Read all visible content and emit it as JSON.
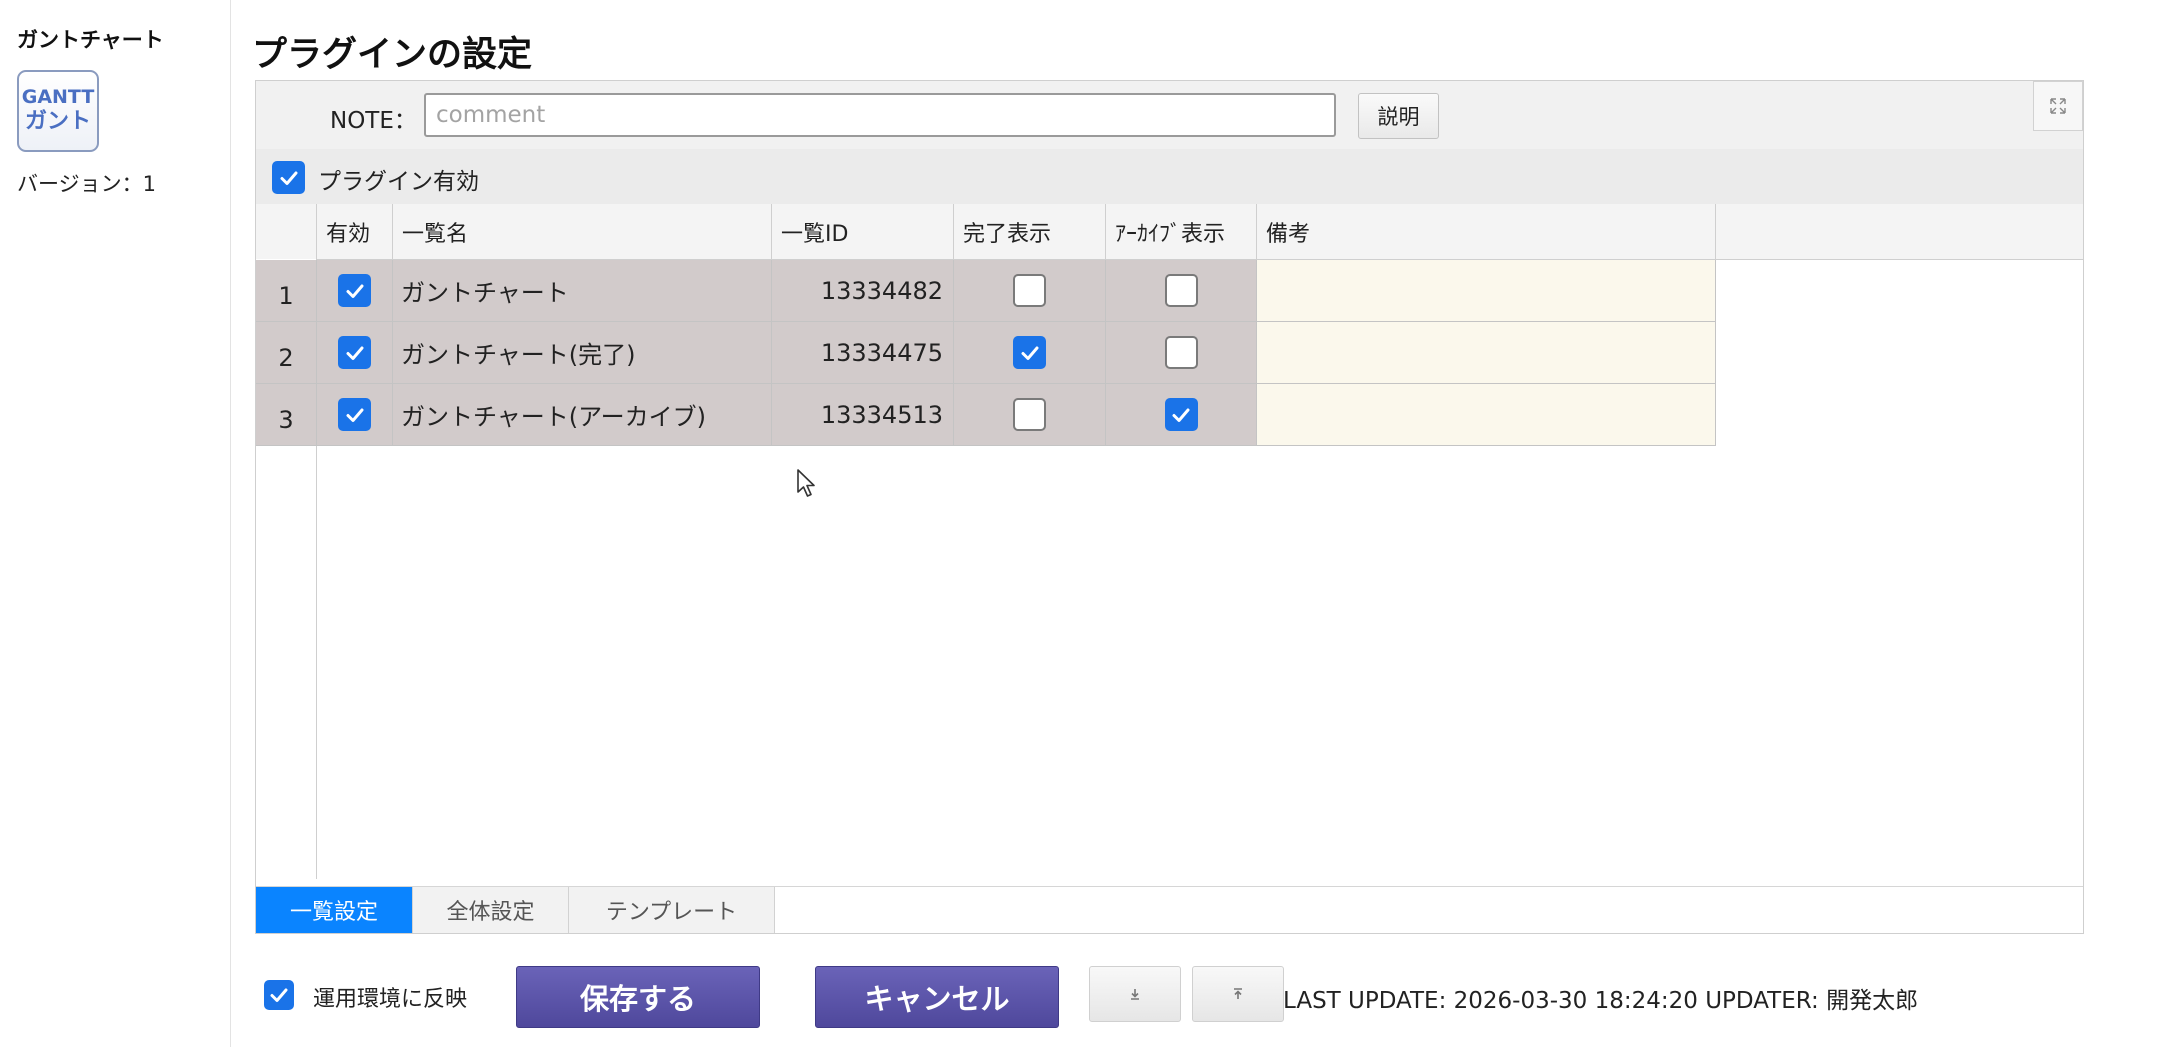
{
  "sidebar": {
    "title": "ガントチャート",
    "logo": {
      "line1": "GANTT",
      "line2": "ガント"
    },
    "version_label": "バージョン：",
    "version_value": "1"
  },
  "header": {
    "title": "プラグインの設定"
  },
  "note": {
    "label": "NOTE：",
    "placeholder": "comment",
    "value": "",
    "explain_label": "説明"
  },
  "plugin_enabled": {
    "label": "プラグイン有効",
    "checked": true
  },
  "grid": {
    "columns": [
      "有効",
      "一覧名",
      "一覧ID",
      "完了表示",
      "ｱｰｶｲﾌﾞ表示",
      "備考"
    ],
    "rows": [
      {
        "num": "1",
        "enabled": true,
        "name": "ガントチャート",
        "id": "13334482",
        "show_done": false,
        "show_archive": false,
        "note": ""
      },
      {
        "num": "2",
        "enabled": true,
        "name": "ガントチャート(完了)",
        "id": "13334475",
        "show_done": true,
        "show_archive": false,
        "note": ""
      },
      {
        "num": "3",
        "enabled": true,
        "name": "ガントチャート(アーカイブ)",
        "id": "13334513",
        "show_done": false,
        "show_archive": true,
        "note": ""
      }
    ]
  },
  "tabs": [
    {
      "label": "一覧設定",
      "active": true
    },
    {
      "label": "全体設定",
      "active": false
    },
    {
      "label": "テンプレート",
      "active": false
    }
  ],
  "footer": {
    "deploy_label": "運用環境に反映",
    "deploy_checked": true,
    "save_label": "保存する",
    "cancel_label": "キャンセル",
    "last_update": "LAST UPDATE: 2026-03-30 18:24:20 UPDATER: 開発太郎"
  },
  "colors": {
    "accent": "#1a73e8",
    "tab_active": "#0a84ff",
    "primary_button": "#5a53a8",
    "row_bg": "#d2cbcb",
    "note_bg": "#fbf8ec"
  }
}
